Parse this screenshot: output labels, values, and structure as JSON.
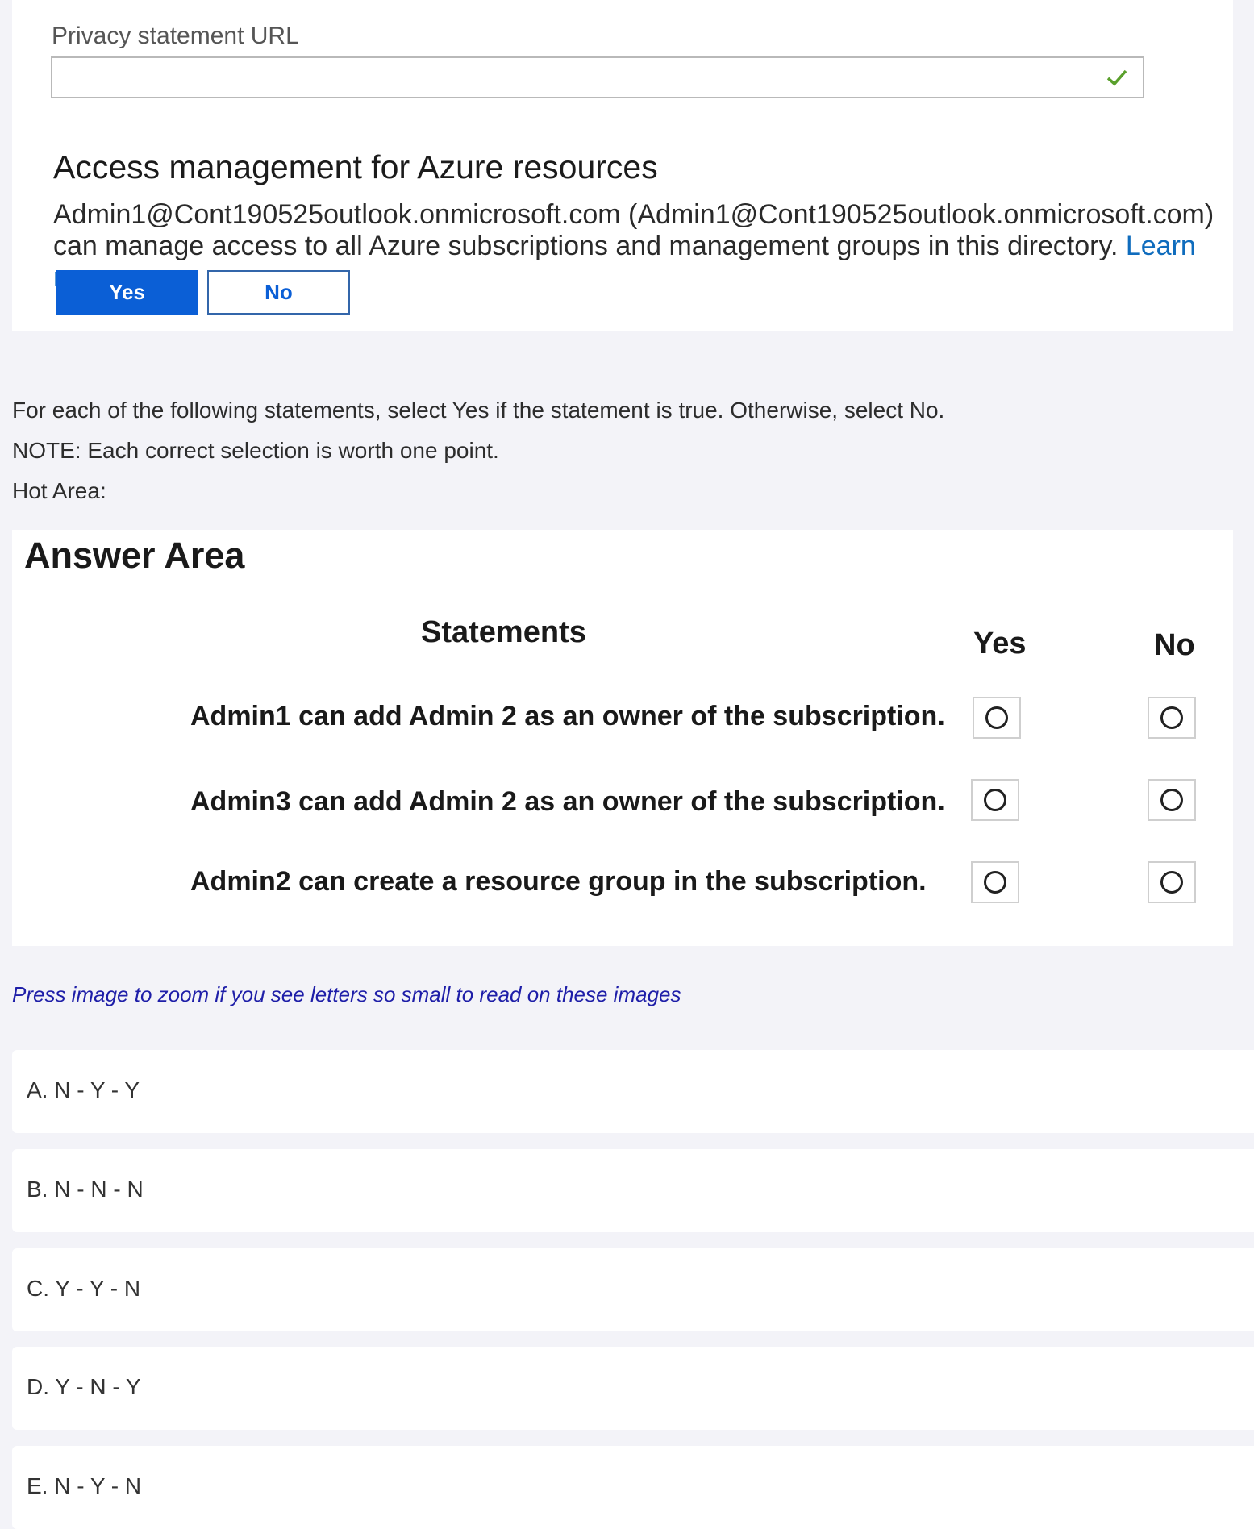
{
  "top": {
    "privacy_label": "Privacy statement URL",
    "url_value": "",
    "section_heading": "Access management for Azure resources",
    "description": "Admin1@Cont190525outlook.onmicrosoft.com (Admin1@Cont190525outlook.onmicrosoft.com) can manage access to all Azure subscriptions and management groups in this directory.",
    "learn_more": "Learn more",
    "yes_label": "Yes",
    "no_label": "No",
    "selected": "Yes"
  },
  "instructions": {
    "line1": "For each of the following statements, select Yes if the statement is true. Otherwise, select No.",
    "line2": "NOTE: Each correct selection is worth one point.",
    "line3": "Hot Area:"
  },
  "answer_area": {
    "title": "Answer Area",
    "col_statements": "Statements",
    "col_yes": "Yes",
    "col_no": "No",
    "statements": [
      "Admin1 can add Admin 2 as an owner of the subscription.",
      "Admin3 can add Admin 2 as an owner of the subscription.",
      "Admin2 can create a resource group in the subscription."
    ]
  },
  "zoom_note": "Press image to zoom if you see letters so small to read on these images",
  "options": [
    "A. N - Y - Y",
    "B. N - N - N",
    "C. Y - Y - N",
    "D. Y - N - Y",
    "E. N - Y - N"
  ],
  "colors": {
    "accent": "#0b5fd6",
    "link": "#0f6cbd",
    "check": "#5aa02c",
    "note": "#1e1ea8"
  }
}
